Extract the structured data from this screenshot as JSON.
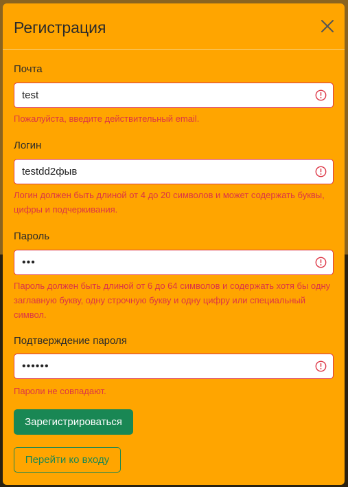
{
  "modal": {
    "title": "Регистрация"
  },
  "form": {
    "email": {
      "label": "Почта",
      "value": "test",
      "error": "Пожалуйста, введите действительный email."
    },
    "login": {
      "label": "Логин",
      "value": "testdd2фыв",
      "error": "Логин должен быть длиной от 4 до 20 символов и может содержать буквы, цифры и подчеркивания."
    },
    "password": {
      "label": "Пароль",
      "value": "abc",
      "error": "Пароль должен быть длиной от 6 до 64 символов и содержать хотя бы одну заглавную букву, одну строчную букву и одну цифру или специальный символ."
    },
    "password_confirm": {
      "label": "Подтверждение пароля",
      "value": "abcdef",
      "error": "Пароли не совпадают."
    }
  },
  "actions": {
    "register_label": "Зарегистрироваться",
    "login_label": "Перейти ко входу"
  },
  "colors": {
    "modal_background": "#ffa500",
    "error": "#dc3545",
    "success": "#198754"
  },
  "icons": {
    "close": "close-icon",
    "invalid": "warning-circle-icon"
  }
}
